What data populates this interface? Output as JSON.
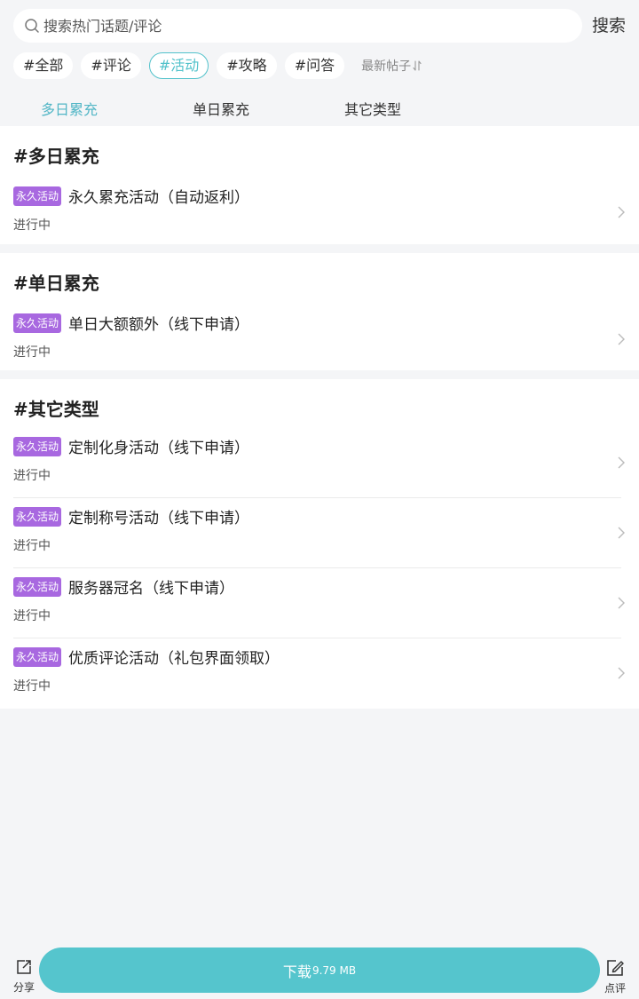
{
  "search": {
    "placeholder": "搜索热门话题/评论",
    "button": "搜索"
  },
  "chips": [
    {
      "label": "#全部"
    },
    {
      "label": "#评论"
    },
    {
      "label": "#活动"
    },
    {
      "label": "#攻略"
    },
    {
      "label": "#问答"
    }
  ],
  "active_chip": "#活动",
  "sort": {
    "label": "最新帖子",
    "icon": "sort-arrows-icon"
  },
  "tabs": [
    {
      "label": "多日累充"
    },
    {
      "label": "单日累充"
    },
    {
      "label": "其它类型"
    }
  ],
  "sections": [
    {
      "title": "#多日累充",
      "items": [
        {
          "tag": "永久活动",
          "title": "永久累充活动（自动返利）",
          "status": "进行中"
        }
      ]
    },
    {
      "title": "#单日累充",
      "items": [
        {
          "tag": "永久活动",
          "title": "单日大额额外（线下申请）",
          "status": "进行中"
        }
      ]
    },
    {
      "title": "#其它类型",
      "items": [
        {
          "tag": "永久活动",
          "title": "定制化身活动（线下申请）",
          "status": "进行中"
        },
        {
          "tag": "永久活动",
          "title": "定制称号活动（线下申请）",
          "status": "进行中"
        },
        {
          "tag": "永久活动",
          "title": "服务器冠名（线下申请）",
          "status": "进行中"
        },
        {
          "tag": "永久活动",
          "title": "优质评论活动（礼包界面领取）",
          "status": "进行中"
        }
      ]
    }
  ],
  "bottom": {
    "share": "分享",
    "download_label": "下载",
    "download_size": "9.79 MB",
    "review": "点评"
  },
  "colors": {
    "accent": "#52c2cb",
    "tag": "#a868e0",
    "background": "#f4f5f7"
  }
}
